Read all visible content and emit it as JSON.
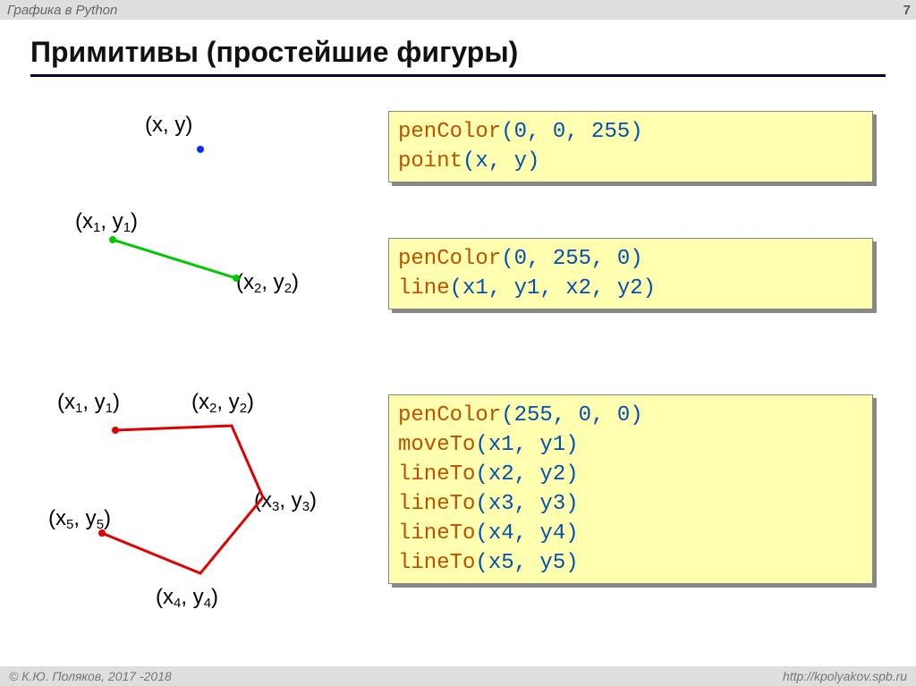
{
  "header": {
    "title": "Графика в Python",
    "page": "7"
  },
  "heading": "Примитивы (простейшие фигуры)",
  "labels": {
    "xy": "(x, y)",
    "p11": "(x₁, y₁)",
    "p12": "(x₂, y₂)",
    "p21": "(x₁, y₁)",
    "p22": "(x₂, y₂)",
    "p23": "(x₃, y₃)",
    "p24": "(x₄, y₄)",
    "p25": "(x₅, y₅)"
  },
  "code": {
    "block1": {
      "l1_fn": "penColor",
      "l1_args": "(0, 0, 255)",
      "l2_fn": "point",
      "l2_args": "(x, y)"
    },
    "block2": {
      "l1_fn": "penColor",
      "l1_args": "(0, 255, 0)",
      "l2_fn": "line",
      "l2_args": "(x1, y1, x2, y2)"
    },
    "block3": {
      "l1_fn": "penColor",
      "l1_args": "(255, 0, 0)",
      "l2_fn": "moveTo",
      "l2_args": "(x1, y1)",
      "l3_fn": "lineTo",
      "l3_args": "(x2, y2)",
      "l4_fn": "lineTo",
      "l4_args": "(x3, y3)",
      "l5_fn": "lineTo",
      "l5_args": "(x4, y4)",
      "l6_fn": "lineTo",
      "l6_args": "(x5, y5)"
    }
  },
  "footer": {
    "copyright": "© К.Ю. Поляков, 2017 -2018",
    "url": "http://kpolyakov.spb.ru"
  }
}
